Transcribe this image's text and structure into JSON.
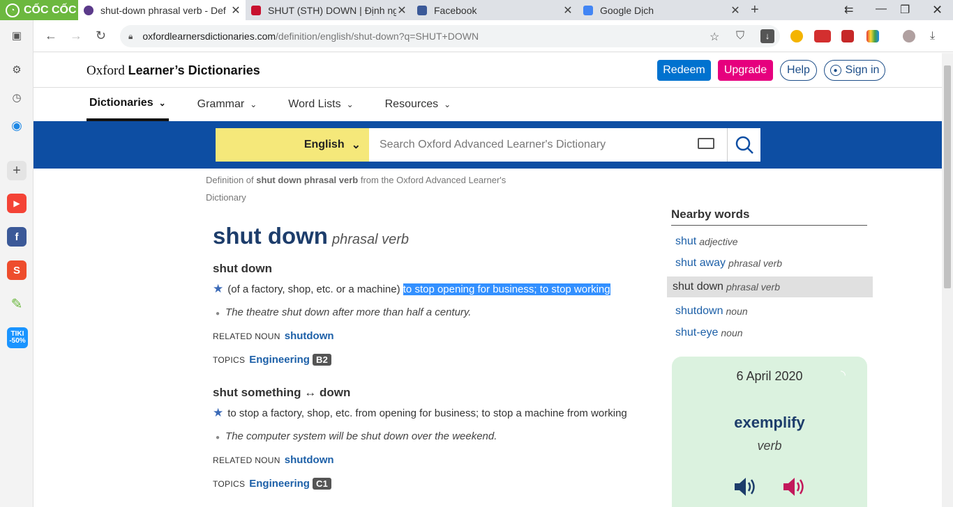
{
  "browser": {
    "brand": "CỐC CỐC",
    "tabs": [
      {
        "title": "shut-down phrasal verb - Def",
        "active": true,
        "icon": "oxford-icon"
      },
      {
        "title": "SHUT (STH) DOWN | Định ngh",
        "active": false,
        "icon": "cambridge-icon"
      },
      {
        "title": "Facebook",
        "active": false,
        "icon": "facebook-icon"
      },
      {
        "title": "Google Dịch",
        "active": false,
        "icon": "google-translate-icon"
      }
    ],
    "url_host": "oxfordlearnersdictionaries.com",
    "url_path": "/definition/english/shut-down?q=SHUT+DOWN"
  },
  "sidebar": {
    "tiki_badge": "TIKI -50%"
  },
  "site": {
    "logo_plain": "Oxford",
    "logo_bold": "Learner’s Dictionaries",
    "redeem": "Redeem",
    "upgrade": "Upgrade",
    "help": "Help",
    "signin": "Sign in",
    "nav": [
      "Dictionaries",
      "Grammar",
      "Word Lists",
      "Resources"
    ],
    "language": "English",
    "search_placeholder": "Search Oxford Advanced Learner's Dictionary"
  },
  "breadcrumb": {
    "prefix": "Definition of",
    "term": "shut down phrasal verb",
    "suffix": "from the Oxford Advanced Learner's Dictionary"
  },
  "entry": {
    "headword": "shut down",
    "pos": "phrasal verb",
    "senses": [
      {
        "shortcut": "shut down",
        "def_prefix": "(of a factory, shop, etc. or a machine)",
        "def_highlight": "to stop opening for business; to stop working",
        "example": "The theatre shut down after more than half a century.",
        "related_label": "RELATED NOUN",
        "related_word": "shutdown",
        "topics_label": "TOPICS",
        "topic": "Engineering",
        "level": "B2"
      },
      {
        "shortcut": "shut something ↔ down",
        "def_prefix": "",
        "def_highlight": "to stop a factory, shop, etc. from opening for business; to stop a machine from working",
        "example": "The computer system will be shut down over the weekend.",
        "related_label": "RELATED NOUN",
        "related_word": "shutdown",
        "topics_label": "TOPICS",
        "topic": "Engineering",
        "level": "C1"
      }
    ]
  },
  "nearby": {
    "title": "Nearby words",
    "items": [
      {
        "word": "shut",
        "pos": "adjective"
      },
      {
        "word": "shut away",
        "pos": "phrasal verb"
      },
      {
        "word": "shut down",
        "pos": "phrasal verb"
      },
      {
        "word": "shutdown",
        "pos": "noun"
      },
      {
        "word": "shut-eye",
        "pos": "noun"
      }
    ]
  },
  "word_of_day": {
    "date": "6 April 2020",
    "word": "exemplify",
    "pos": "verb"
  },
  "colors": {
    "brand_green": "#6cb83f",
    "oxford_blue": "#0d4ea3",
    "redeem": "#0072cf",
    "upgrade": "#e6007e",
    "highlight": "#3390ff"
  }
}
